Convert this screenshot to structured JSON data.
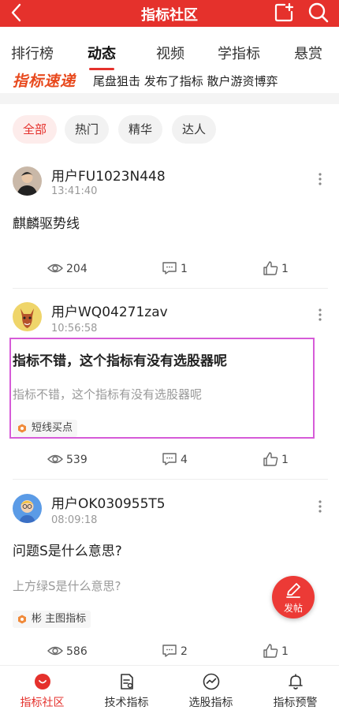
{
  "header": {
    "title": "指标社区"
  },
  "tabs": [
    {
      "label": "排行榜"
    },
    {
      "label": "动态"
    },
    {
      "label": "视频"
    },
    {
      "label": "学指标"
    },
    {
      "label": "悬赏"
    }
  ],
  "ticker": {
    "logo_text": "指标速递",
    "text": "尾盘狙击 发布了指标 散户游资博弈"
  },
  "filters": [
    {
      "label": "全部"
    },
    {
      "label": "热门"
    },
    {
      "label": "精华"
    },
    {
      "label": "达人"
    }
  ],
  "posts": [
    {
      "user": "用户FU1023N448",
      "time": "13:41:40",
      "title": "麒麟驱势线",
      "subtitle": "",
      "tag": "",
      "views": "204",
      "comments": "1",
      "likes": "1"
    },
    {
      "user": "用户WQ04271zav",
      "time": "10:56:58",
      "title": "指标不错，这个指标有没有选股器呢",
      "subtitle": "指标不错，这个指标有没有选股器呢",
      "tag": "短线买点",
      "views": "539",
      "comments": "4",
      "likes": "1"
    },
    {
      "user": "用户OK030955T5",
      "time": "08:09:18",
      "title": "问题S是什么意思?",
      "subtitle": "上方绿S是什么意思?",
      "tag": "彬 主图指标",
      "views": "586",
      "comments": "2",
      "likes": "1"
    }
  ],
  "fab": {
    "label": "发帖"
  },
  "bottom_nav": [
    {
      "label": "指标社区"
    },
    {
      "label": "技术指标"
    },
    {
      "label": "选股指标"
    },
    {
      "label": "指标预警"
    }
  ],
  "colors": {
    "brand": "#e5312c",
    "highlight_border": "#d65bd8"
  }
}
